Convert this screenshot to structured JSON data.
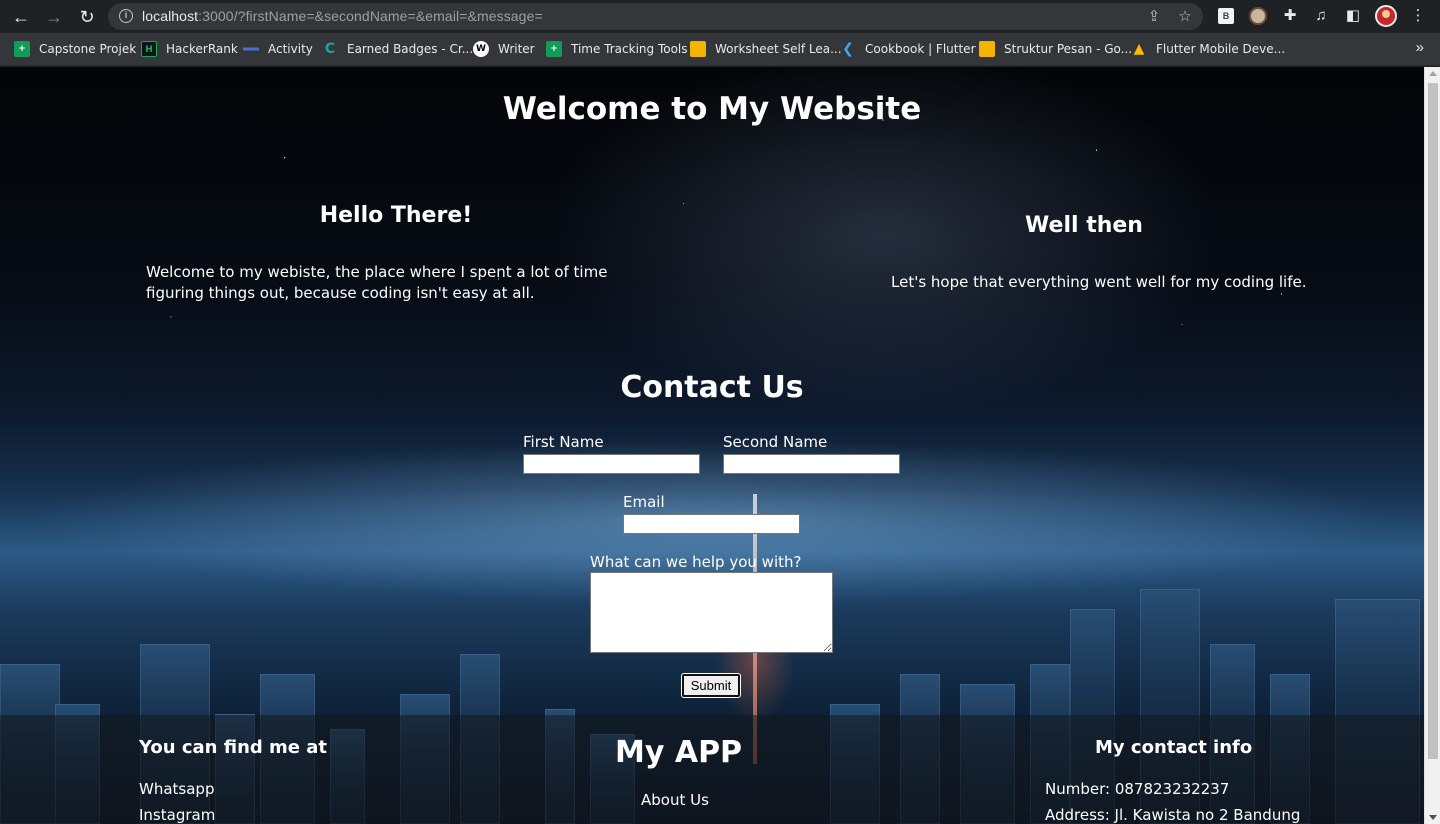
{
  "browser": {
    "url_host": "localhost",
    "url_rest": ":3000/?firstName=&secondName=&email=&message=",
    "bookmarks": [
      {
        "label": "Capstone Projek",
        "icon": "sheets-plus-icon",
        "color": "#0f9d58"
      },
      {
        "label": "HackerRank",
        "icon": "hackerrank-icon",
        "color": "#1ba94c"
      },
      {
        "label": "Activity",
        "icon": "activity-icon",
        "color": "#4a6fd8"
      },
      {
        "label": "Earned Badges - Cr...",
        "icon": "coursera-badge-icon",
        "color": "#1aa5a5"
      },
      {
        "label": "Writer",
        "icon": "writer-w-icon",
        "color": "#ffffff"
      },
      {
        "label": "Time Tracking Tools",
        "icon": "sheets-plus-icon",
        "color": "#0f9d58"
      },
      {
        "label": "Worksheet Self Lea...",
        "icon": "slides-yellow-icon",
        "color": "#f4b400"
      },
      {
        "label": "Cookbook | Flutter",
        "icon": "flutter-icon",
        "color": "#42a5f5"
      },
      {
        "label": "Struktur Pesan - Go...",
        "icon": "slides-yellow-icon",
        "color": "#f4b400"
      },
      {
        "label": "Flutter Mobile Deve...",
        "icon": "google-drive-icon",
        "color": "#fbbc04"
      }
    ],
    "overflow_icon": "»"
  },
  "page": {
    "heading": "Welcome to My Website",
    "left_section": {
      "title": "Hello There!",
      "text": "Welcome to my webiste, the place where I spent a lot of time figuring things out, because coding isn't easy at all."
    },
    "right_section": {
      "title": "Well then",
      "text": "Let's hope that everything went well for my coding life."
    },
    "contact": {
      "title": "Contact Us",
      "first_name_label": "First Name",
      "first_name_value": "",
      "second_name_label": "Second Name",
      "second_name_value": "",
      "email_label": "Email",
      "email_value": "",
      "message_label": "What can we help you with?",
      "message_value": "",
      "submit_label": "Submit"
    },
    "footer": {
      "find_me_title": "You can find me at",
      "find_me_links": [
        "Whatsapp",
        "Instagram"
      ],
      "brand": "My APP",
      "center_links": [
        "About Us"
      ],
      "contact_title": "My contact info",
      "number": "Number: 087823232237",
      "address": "Address: Jl. Kawista no 2 Bandung"
    }
  }
}
